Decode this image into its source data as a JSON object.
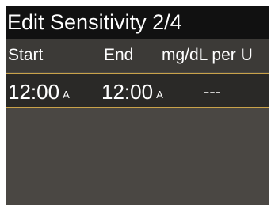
{
  "title": "Edit Sensitivity 2/4",
  "columns": {
    "start": "Start",
    "end": "End",
    "units": "mg/dL per U"
  },
  "rows": [
    {
      "start_time": "12:00",
      "start_ampm": "A",
      "end_time": "12:00",
      "end_ampm": "A",
      "sensitivity": "---"
    }
  ],
  "colors": {
    "title_bg": "#111111",
    "screen_bg": "#4a4743",
    "header_bg": "#3c3a37",
    "selected_row_bg": "#2a2927",
    "selected_row_border": "#c9a24a",
    "text": "#ffffff"
  }
}
